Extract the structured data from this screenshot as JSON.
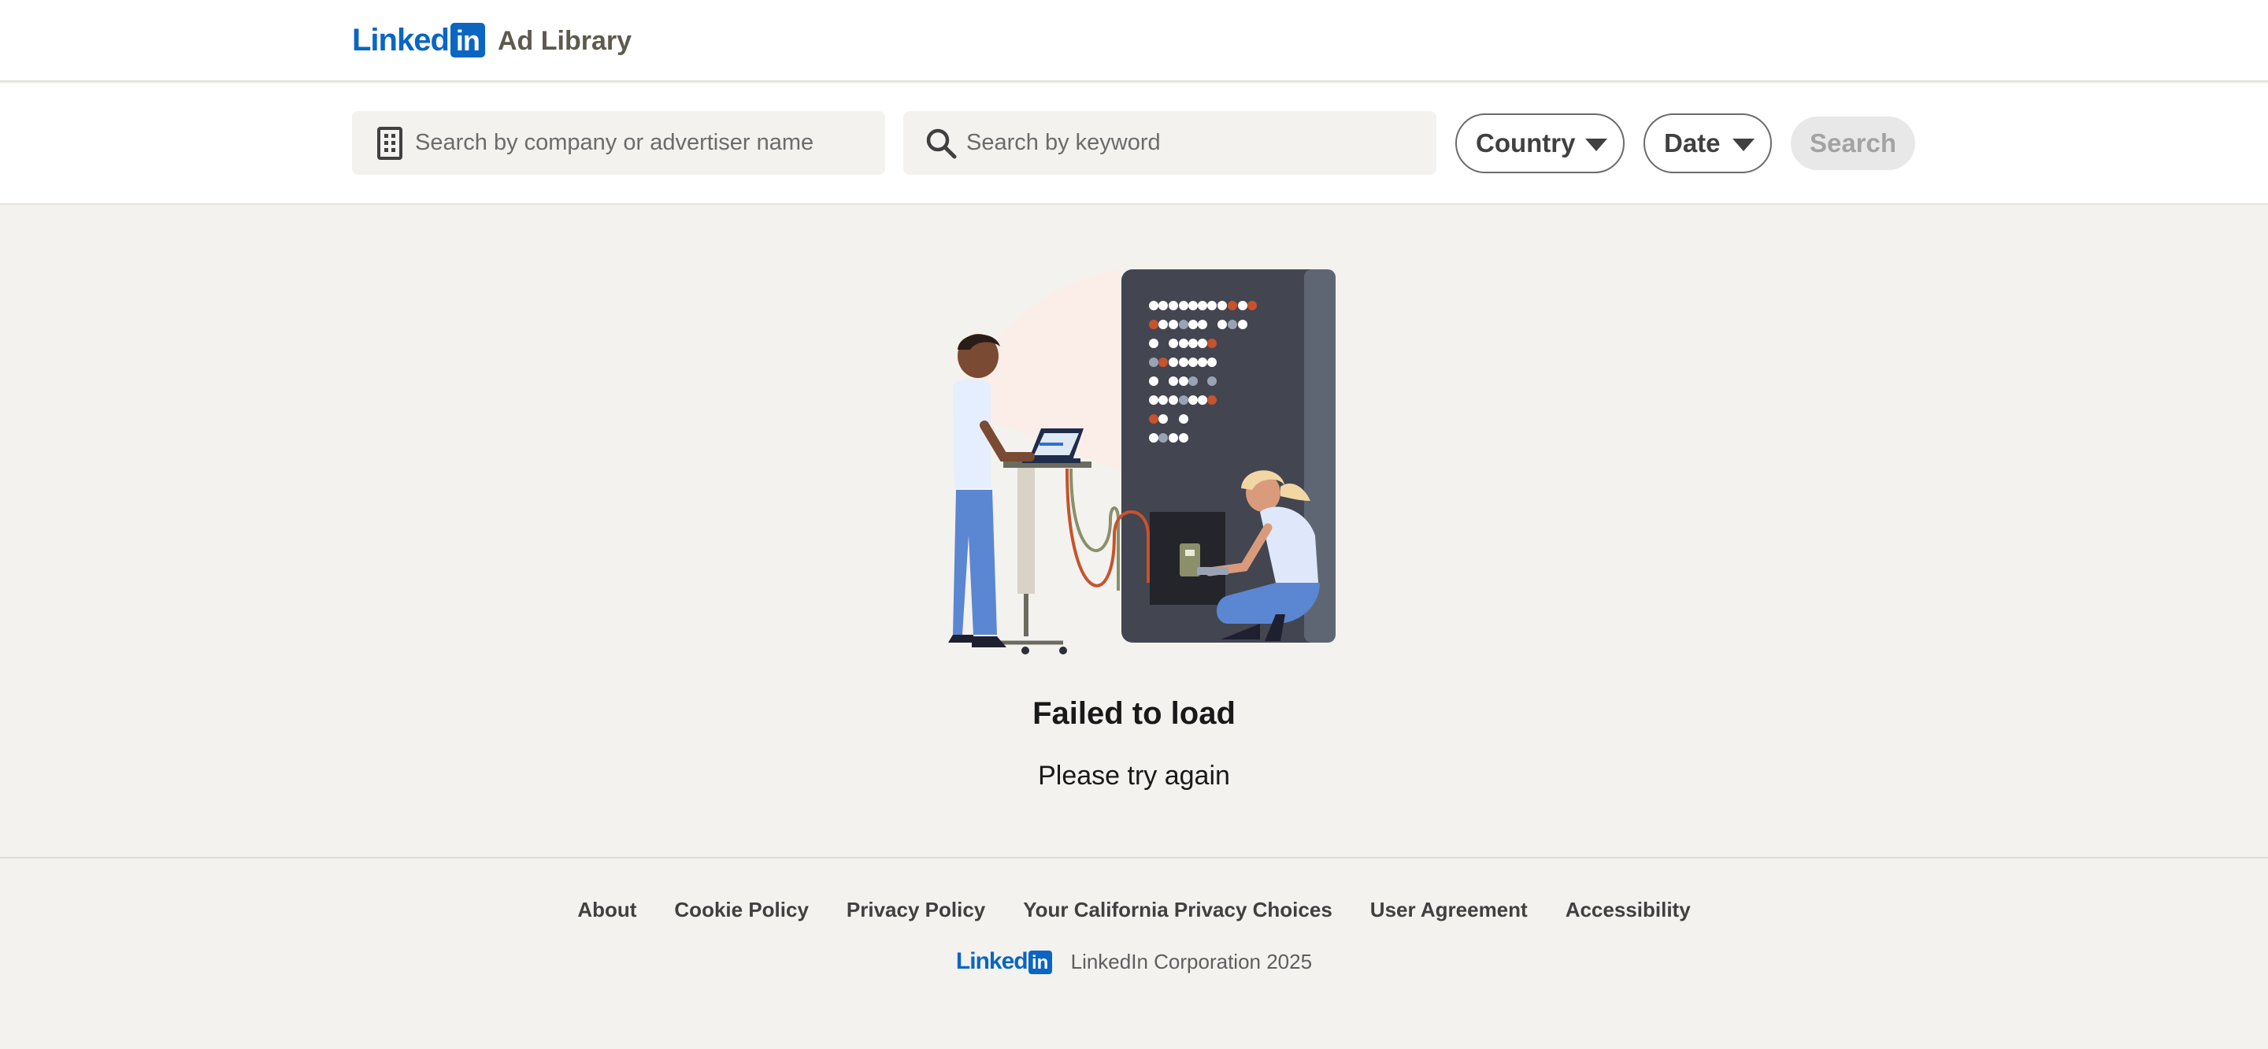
{
  "header": {
    "logo_text": "Linked",
    "logo_badge": "in",
    "product_name": "Ad Library"
  },
  "search": {
    "company_placeholder": "Search by company or advertiser name",
    "keyword_placeholder": "Search by keyword",
    "country_label": "Country",
    "date_label": "Date",
    "search_button": "Search"
  },
  "error": {
    "title": "Failed to load",
    "subtitle": "Please try again"
  },
  "footer": {
    "links": [
      "About",
      "Cookie Policy",
      "Privacy Policy",
      "Your California Privacy Choices",
      "User Agreement",
      "Accessibility"
    ],
    "logo_text": "Linked",
    "logo_badge": "in",
    "copyright": "LinkedIn Corporation 2025"
  },
  "colors": {
    "brand_blue": "#0a66c2",
    "page_bg": "#f3f2ef",
    "server_dark": "#434650",
    "accent_orange": "#c7532c"
  }
}
